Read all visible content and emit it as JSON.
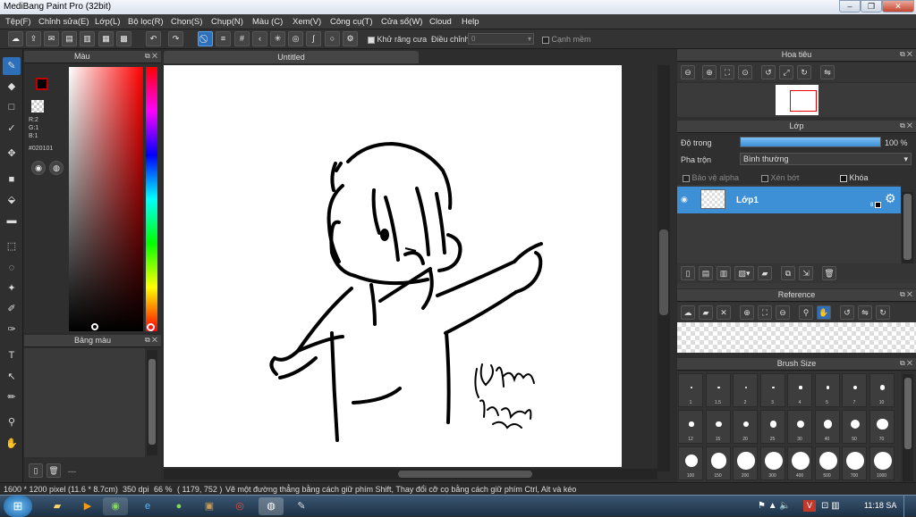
{
  "window": {
    "title": "MediBang Paint Pro (32bit)",
    "minimize": "–",
    "maximize": "❐",
    "close": "✕"
  },
  "menu": [
    "Tệp(F)",
    "Chỉnh sửa(E)",
    "Lớp(L)",
    "Bộ lọc(R)",
    "Chọn(S)",
    "Chụp(N)",
    "Màu (C)",
    "Xem(V)",
    "Công cụ(T)",
    "Cửa sổ(W)",
    "Cloud",
    "Help"
  ],
  "toolbar": {
    "antialias_label": "Khử răng cưa",
    "correction_label": "Điều chỉnh",
    "correction_value": "0",
    "edge_label": "Cạnh mềm"
  },
  "color_panel": {
    "title": "Màu",
    "r": "R:2",
    "g": "G:1",
    "b": "B:1",
    "hex": "#020101",
    "fg_color": "#020101",
    "accent_color": "#c00000"
  },
  "swatch_panel": {
    "title": "Bảng màu",
    "footer": "---"
  },
  "canvas": {
    "tab_title": "Untitled"
  },
  "navigator": {
    "title": "Hoa tiêu"
  },
  "layers": {
    "title": "Lớp",
    "opacity_label": "Độ trong",
    "opacity_value": "100 %",
    "opacity_fraction": 1.0,
    "blend_label": "Pha trộn",
    "blend_value": "Bình thường",
    "protect_alpha": "Bảo vệ alpha",
    "clipping": "Xén bớt",
    "lock": "Khóa",
    "items": [
      {
        "name": "Lớp1",
        "badge": "8"
      }
    ]
  },
  "reference": {
    "title": "Reference"
  },
  "brush_size": {
    "title": "Brush Size",
    "sizes": [
      "1",
      "1.5",
      "2",
      "3",
      "4",
      "5",
      "7",
      "10",
      "12",
      "15",
      "20",
      "25",
      "30",
      "40",
      "50",
      "70",
      "100",
      "150",
      "200",
      "300",
      "400",
      "500",
      "700",
      "1000"
    ]
  },
  "status": {
    "dimensions": "1600 * 1200 pixel",
    "size_cm": "(11.6 * 8.7cm)",
    "dpi": "350 dpi",
    "zoom": "66 %",
    "coords": "( 1179, 752 )",
    "hint": "Vẽ một đường thẳng bằng cách giữ phím Shift, Thay đổi cỡ cọ bằng cách giữ phím Ctrl, Alt và kéo"
  },
  "taskbar": {
    "clock": "11:18 SA"
  }
}
